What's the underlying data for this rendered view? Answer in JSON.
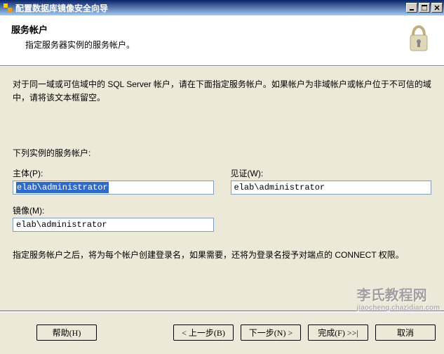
{
  "window": {
    "title": "配置数据库镜像安全向导"
  },
  "header": {
    "title": "服务帐户",
    "subtitle": "指定服务器实例的服务帐户。"
  },
  "intro": "对于同一域或可信域中的 SQL Server 帐户，请在下面指定服务帐户。如果帐户为非域帐户或帐户位于不可信的域中，请将该文本框留空。",
  "section_label": "下列实例的服务帐户:",
  "fields": {
    "principal": {
      "label": "主体(P):",
      "value": "elab\\administrator"
    },
    "witness": {
      "label": "见证(W):",
      "value": "elab\\administrator"
    },
    "mirror": {
      "label": "镜像(M):",
      "value": "elab\\administrator"
    }
  },
  "hint": "指定服务帐户之后，将为每个帐户创建登录名，如果需要，还将为登录名授予对端点的 CONNECT 权限。",
  "buttons": {
    "help": "帮助(H)",
    "back": "< 上一步(B)",
    "next": "下一步(N) >",
    "finish": "完成(F) >>|",
    "cancel": "取消"
  },
  "watermark": {
    "main": "李氏教程网",
    "sub": "jiaocheng.chazidian.com"
  }
}
